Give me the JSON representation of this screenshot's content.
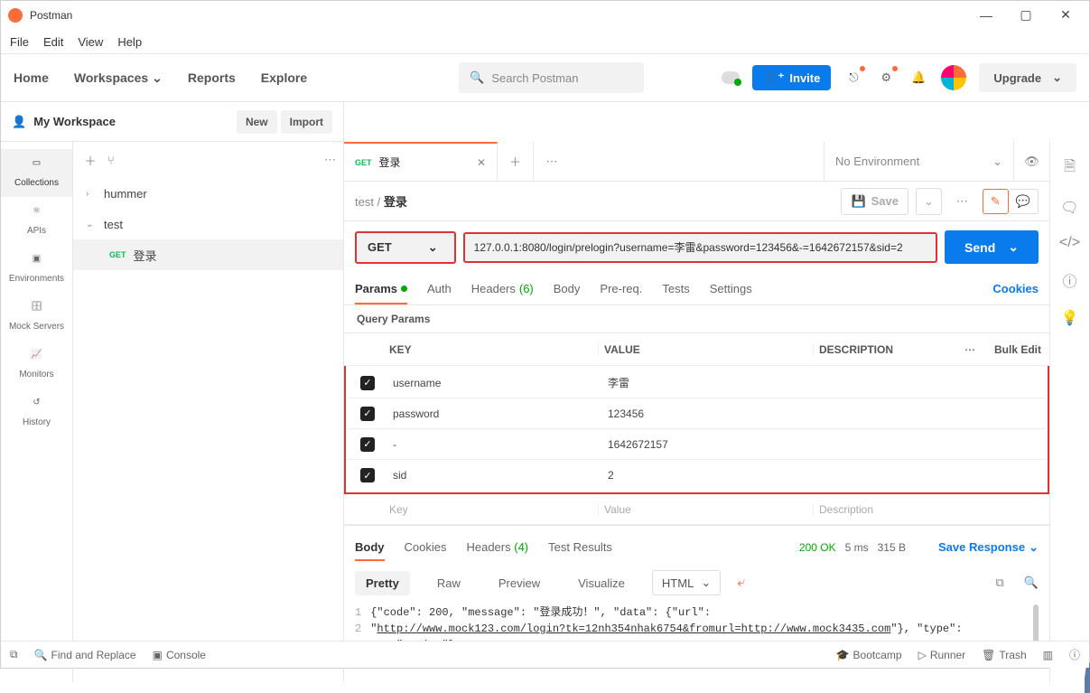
{
  "app": {
    "title": "Postman"
  },
  "menu": {
    "file": "File",
    "edit": "Edit",
    "view": "View",
    "help": "Help"
  },
  "nav": {
    "home": "Home",
    "workspaces": "Workspaces",
    "reports": "Reports",
    "explore": "Explore",
    "search_placeholder": "Search Postman",
    "invite": "Invite",
    "upgrade": "Upgrade"
  },
  "workspace": {
    "name": "My Workspace",
    "new": "New",
    "import": "Import"
  },
  "left_categories": {
    "collections": "Collections",
    "apis": "APIs",
    "environments": "Environments",
    "mock": "Mock Servers",
    "monitors": "Monitors",
    "history": "History"
  },
  "tree": {
    "folder1": "hummer",
    "folder2": "test",
    "request_method": "GET",
    "request_name": "登录"
  },
  "tab": {
    "method": "GET",
    "name": "登录",
    "no_env": "No Environment"
  },
  "breadcrumb": {
    "parent": "test",
    "sep": "/",
    "current": "登录",
    "save": "Save"
  },
  "request": {
    "method": "GET",
    "url": "127.0.0.1:8080/login/prelogin?username=李雷&password=123456&-=1642672157&sid=2",
    "send": "Send"
  },
  "req_tabs": {
    "params": "Params",
    "auth": "Auth",
    "headers": "Headers",
    "headers_count": "(6)",
    "body": "Body",
    "prereq": "Pre-req.",
    "tests": "Tests",
    "settings": "Settings",
    "cookies": "Cookies"
  },
  "qp": {
    "title": "Query Params",
    "col_key": "KEY",
    "col_val": "VALUE",
    "col_desc": "DESCRIPTION",
    "bulk": "Bulk Edit",
    "rows": [
      {
        "key": "username",
        "value": "李雷"
      },
      {
        "key": "password",
        "value": "123456"
      },
      {
        "key": "-",
        "value": "1642672157"
      },
      {
        "key": "sid",
        "value": "2"
      }
    ],
    "ph_key": "Key",
    "ph_val": "Value",
    "ph_desc": "Description"
  },
  "resp_tabs": {
    "body": "Body",
    "cookies": "Cookies",
    "headers": "Headers",
    "headers_count": "(4)",
    "tests": "Test Results",
    "status_code": "200 OK",
    "time": "5 ms",
    "size": "315 B",
    "save": "Save Response"
  },
  "resp_tools": {
    "pretty": "Pretty",
    "raw": "Raw",
    "preview": "Preview",
    "visualize": "Visualize",
    "format": "HTML"
  },
  "resp_body": {
    "line1": "{\"code\": 200, \"message\": \"登录成功！\", \"data\": {\"url\":",
    "line2a": "\"",
    "line2url": "http://www.mock123.com/login?tk=12nh354nhak6754&fromurl=http://www.mock3435.com",
    "line2b": "\"}, \"type\":",
    "line3": "\"string\"}"
  },
  "footer": {
    "find": "Find and Replace",
    "console": "Console",
    "bootcamp": "Bootcamp",
    "runner": "Runner",
    "trash": "Trash"
  }
}
